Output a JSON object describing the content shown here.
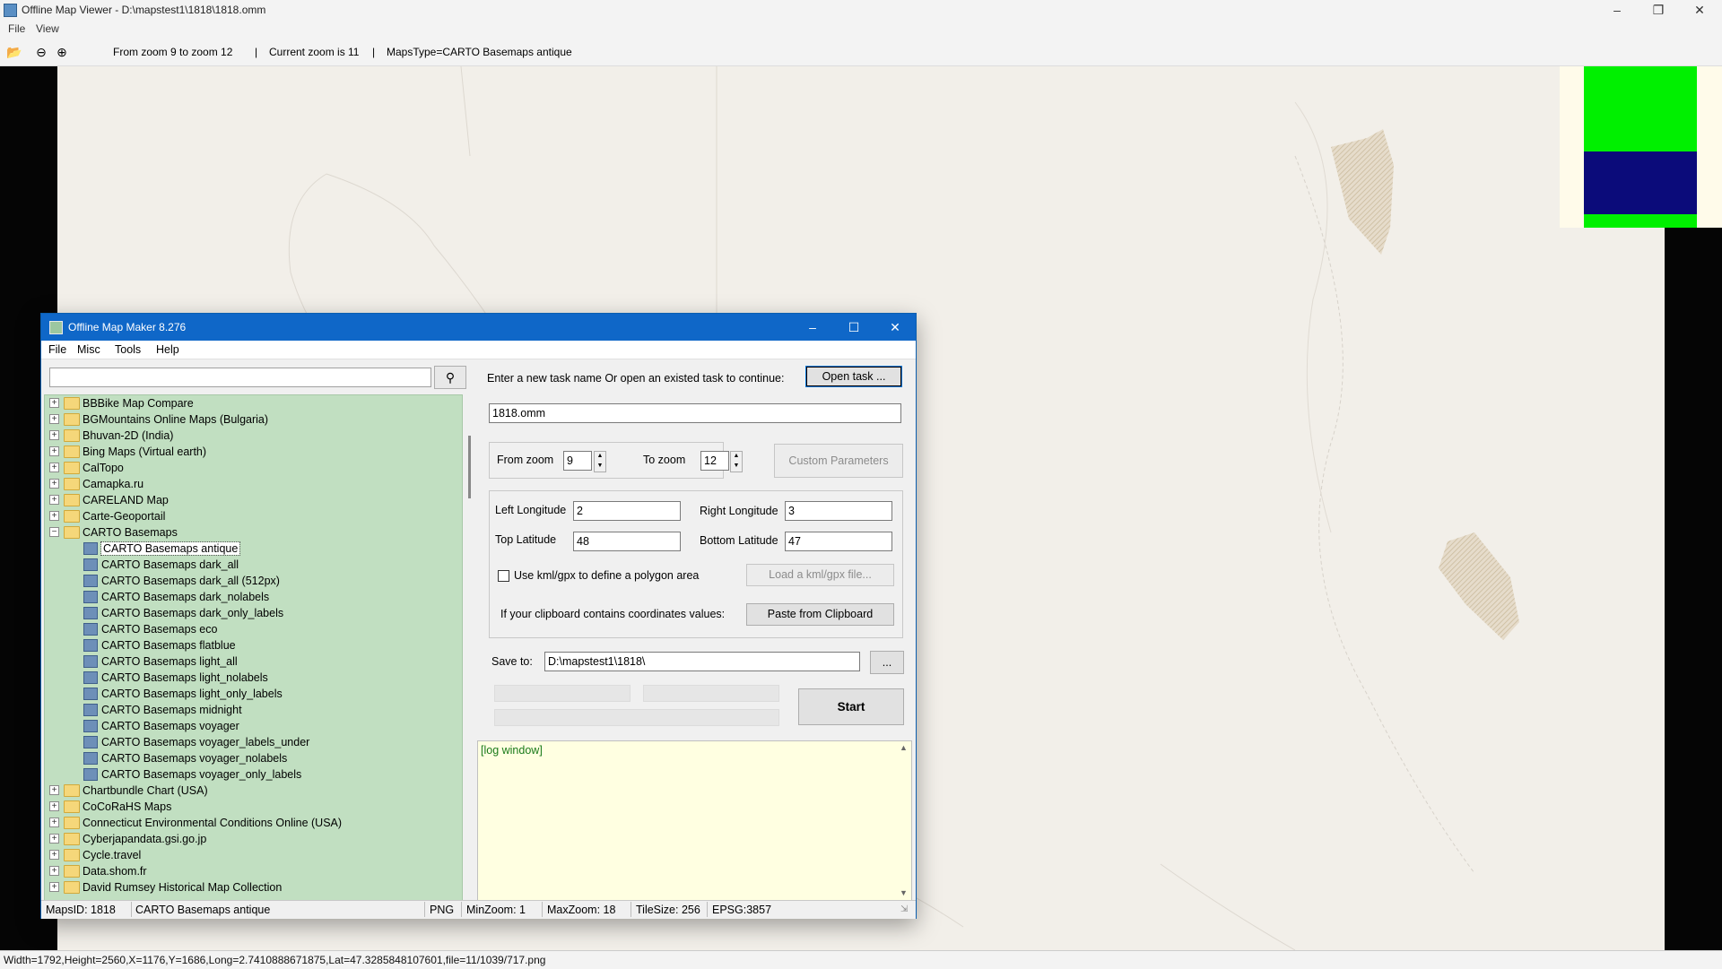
{
  "viewer": {
    "title": "Offline Map Viewer - D:\\mapstest1\\1818\\1818.omm",
    "menu": [
      "File",
      "View"
    ],
    "toolbar_icons": [
      "open-folder-icon",
      "zoom-out-icon",
      "zoom-in-icon"
    ],
    "zoom_range": "From zoom 9 to zoom 12",
    "current_zoom": "Current zoom is 11",
    "maps_type": "MapsType=CARTO Basemaps antique",
    "status": "Width=1792,Height=2560,X=1176,Y=1686,Long=2.7410888671875,Lat=47.3285848107601,file=11/1039/717.png"
  },
  "dialog": {
    "title": "Offline Map Maker 8.276",
    "menu": [
      "File",
      "Misc",
      "Tools",
      "Help"
    ],
    "search": {
      "value": "",
      "icon": "magnifier-icon"
    },
    "tree": [
      {
        "label": "BBBike Map Compare",
        "type": "folder",
        "expanded": false
      },
      {
        "label": "BGMountains Online Maps (Bulgaria)",
        "type": "folder",
        "expanded": false
      },
      {
        "label": "Bhuvan-2D (India)",
        "type": "folder",
        "expanded": false
      },
      {
        "label": "Bing Maps (Virtual earth)",
        "type": "folder",
        "expanded": false
      },
      {
        "label": "CalTopo",
        "type": "folder",
        "expanded": false
      },
      {
        "label": "Camapka.ru",
        "type": "folder",
        "expanded": false
      },
      {
        "label": "CARELAND Map",
        "type": "folder",
        "expanded": false
      },
      {
        "label": "Carte-Geoportail",
        "type": "folder",
        "expanded": false
      },
      {
        "label": "CARTO Basemaps",
        "type": "folder",
        "expanded": true
      },
      {
        "label": "CARTO Basemaps antique",
        "type": "map",
        "selected": true
      },
      {
        "label": "CARTO Basemaps dark_all",
        "type": "map"
      },
      {
        "label": "CARTO Basemaps dark_all (512px)",
        "type": "map"
      },
      {
        "label": "CARTO Basemaps dark_nolabels",
        "type": "map"
      },
      {
        "label": "CARTO Basemaps dark_only_labels",
        "type": "map"
      },
      {
        "label": "CARTO Basemaps eco",
        "type": "map"
      },
      {
        "label": "CARTO Basemaps flatblue",
        "type": "map"
      },
      {
        "label": "CARTO Basemaps light_all",
        "type": "map"
      },
      {
        "label": "CARTO Basemaps light_nolabels",
        "type": "map"
      },
      {
        "label": "CARTO Basemaps light_only_labels",
        "type": "map"
      },
      {
        "label": "CARTO Basemaps midnight",
        "type": "map"
      },
      {
        "label": "CARTO Basemaps voyager",
        "type": "map"
      },
      {
        "label": "CARTO Basemaps voyager_labels_under",
        "type": "map"
      },
      {
        "label": "CARTO Basemaps voyager_nolabels",
        "type": "map"
      },
      {
        "label": "CARTO Basemaps voyager_only_labels",
        "type": "map"
      },
      {
        "label": "Chartbundle Chart (USA)",
        "type": "folder",
        "expanded": false
      },
      {
        "label": "CoCoRaHS Maps",
        "type": "folder",
        "expanded": false
      },
      {
        "label": "Connecticut Environmental Conditions Online (USA)",
        "type": "folder",
        "expanded": false
      },
      {
        "label": "Cyberjapandata.gsi.go.jp",
        "type": "folder",
        "expanded": false
      },
      {
        "label": "Cycle.travel",
        "type": "folder",
        "expanded": false
      },
      {
        "label": "Data.shom.fr",
        "type": "folder",
        "expanded": false
      },
      {
        "label": "David Rumsey Historical Map Collection",
        "type": "folder",
        "expanded": false
      }
    ],
    "task_prompt": "Enter a new task name Or open an existed task to continue:",
    "open_task_label": "Open task ...",
    "task_name": "1818.omm",
    "from_zoom_label": "From zoom",
    "from_zoom": "9",
    "to_zoom_label": "To zoom",
    "to_zoom": "12",
    "custom_params_label": "Custom Parameters",
    "left_lon_label": "Left Longitude",
    "left_lon": "2",
    "right_lon_label": "Right Longitude",
    "right_lon": "3",
    "top_lat_label": "Top Latitude",
    "top_lat": "48",
    "bottom_lat_label": "Bottom Latitude",
    "bottom_lat": "47",
    "kml_checkbox_label": "Use kml/gpx to define a polygon area",
    "kml_checked": false,
    "load_kml_label": "Load a kml/gpx file...",
    "clipboard_prompt": "If your clipboard contains coordinates values:",
    "paste_label": "Paste from Clipboard",
    "save_to_label": "Save to:",
    "save_to": "D:\\mapstest1\\1818\\",
    "browse_label": "...",
    "start_label": "Start",
    "log_text": "[log window]",
    "status": {
      "maps_id": "MapsID: 1818",
      "map_name": "CARTO Basemaps antique",
      "format": "PNG",
      "min_zoom": "MinZoom: 1",
      "max_zoom": "MaxZoom: 18",
      "tile_size": "TileSize: 256",
      "epsg": "EPSG:3857"
    }
  },
  "colors": {
    "dialog_title_bar": "#0f67c8",
    "tree_background": "#c1dfc1",
    "log_background": "#ffffe1",
    "log_text": "#1a7a1a",
    "minimap_green": "#00f000",
    "minimap_blue": "#0b0b7a"
  }
}
